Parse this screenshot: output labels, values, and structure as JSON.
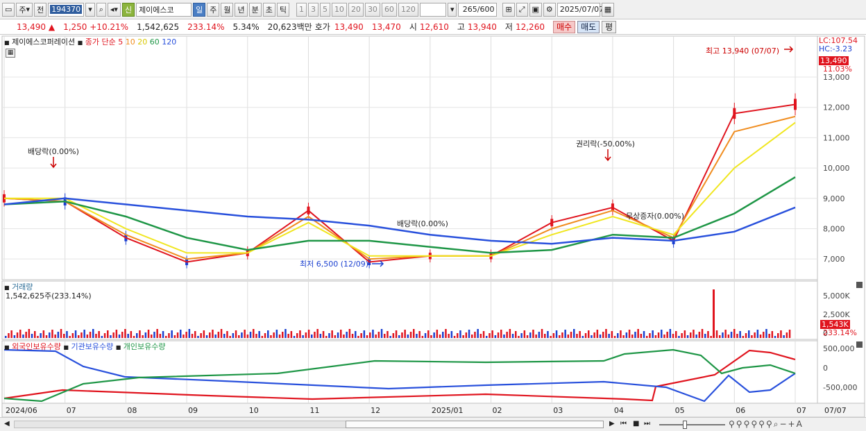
{
  "toolbar": {
    "type1": "주",
    "type2": "전",
    "code": "194370",
    "name": "제이에스코",
    "signal": "신",
    "periods": [
      "일",
      "주",
      "월",
      "년",
      "분",
      "초",
      "틱"
    ],
    "active_period": "일",
    "intervals": [
      "1",
      "3",
      "5",
      "10",
      "20",
      "30",
      "60",
      "120"
    ],
    "count": "265",
    "count_total": "/600",
    "date": "2025/07/07"
  },
  "price": {
    "current": "13,490",
    "arrow": "▲",
    "change": "1,250",
    "change_pct": "+10.21%",
    "volume": "1,542,625",
    "vol_ratio": "233.14%",
    "turnover": "5.34%",
    "amount": "20,623백만",
    "ask_label": "호가",
    "ask": "13,490",
    "bid": "13,470",
    "open_label": "시",
    "open": "12,610",
    "high_label": "고",
    "high": "13,940",
    "low_label": "저",
    "low": "12,260",
    "buy": "매수",
    "sell": "매도",
    "eval": "평"
  },
  "main_chart": {
    "title": "제이에스코퍼레이션",
    "ma_label": "종가 단순",
    "ma_periods": [
      "5",
      "10",
      "20",
      "60",
      "120"
    ],
    "ma_colors": [
      "#e0141e",
      "#f08c1e",
      "#f0e61e",
      "#1e9646",
      "#2850dc"
    ],
    "lc": "LC:107.54",
    "hc": "HC:-3.23",
    "current_tag": "13,490",
    "current_pct": "11.03%",
    "y_ticks": [
      "13,000",
      "12,000",
      "11,000",
      "10,000",
      "9,000",
      "8,000",
      "7,000"
    ],
    "annotations": {
      "high": "최고 13,940 (07/07)",
      "low": "최저 6,500 (12/09)",
      "div1": "배당락(0.00%)",
      "div2": "배당락(0.00%)",
      "rights": "권리락(-50.00%)",
      "bonus": "무상증자(0.00%)"
    }
  },
  "volume_chart": {
    "title": "거래량",
    "value": "1,542,625주(233.14%)",
    "y_ticks": [
      "5,000K",
      "2,500K",
      "0"
    ],
    "current_tag": "1,543K",
    "current_pct": "233.14%"
  },
  "holding_chart": {
    "series": [
      "외국인보유수량",
      "기관보유수량",
      "개인보유수량"
    ],
    "colors": [
      "#e0141e",
      "#2850dc",
      "#1e9646"
    ],
    "y_ticks": [
      "500,000",
      "0",
      "-500,000"
    ]
  },
  "x_axis": {
    "labels": [
      "2024/06",
      "07",
      "08",
      "09",
      "10",
      "11",
      "12",
      "2025/01",
      "02",
      "03",
      "04",
      "05",
      "06",
      "07"
    ],
    "right_label": "07/07"
  },
  "chart_data": {
    "type": "line",
    "title": "제이에스코퍼레이션",
    "x": [
      "2024/06",
      "07",
      "08",
      "09",
      "10",
      "11",
      "12",
      "2025/01",
      "02",
      "03",
      "04",
      "05",
      "06",
      "07"
    ],
    "series": [
      {
        "name": "5",
        "values": [
          9000,
          8900,
          7700,
          6900,
          7200,
          8600,
          6900,
          7100,
          7100,
          8200,
          8700,
          7600,
          11800,
          12100
        ]
      },
      {
        "name": "10",
        "values": [
          9000,
          8900,
          7800,
          7000,
          7200,
          8400,
          7000,
          7100,
          7100,
          8000,
          8600,
          7700,
          11200,
          11700
        ]
      },
      {
        "name": "20",
        "values": [
          9000,
          9000,
          8000,
          7200,
          7200,
          8200,
          7100,
          7100,
          7100,
          7800,
          8400,
          7800,
          10000,
          11500
        ]
      },
      {
        "name": "60",
        "values": [
          8800,
          8900,
          8400,
          7700,
          7300,
          7600,
          7600,
          7400,
          7200,
          7300,
          7800,
          7700,
          8500,
          9700
        ]
      },
      {
        "name": "120",
        "values": [
          8800,
          9000,
          8800,
          8600,
          8400,
          8300,
          8100,
          7800,
          7600,
          7500,
          7700,
          7600,
          7900,
          8700
        ]
      }
    ],
    "ylim": [
      6500,
      13940
    ]
  }
}
